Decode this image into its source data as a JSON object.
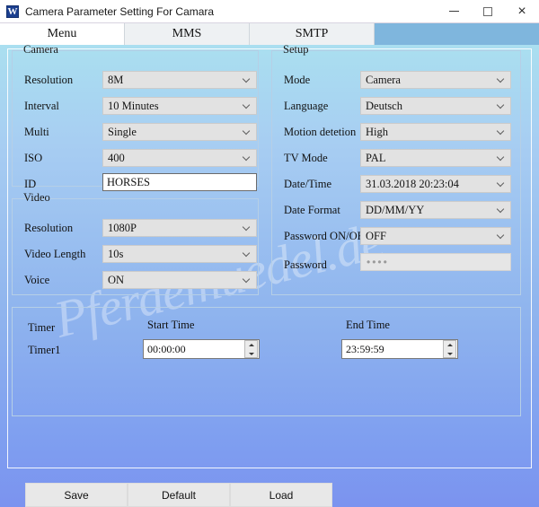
{
  "window": {
    "title": "Camera Parameter Setting For  Camara",
    "icon": "app-icon",
    "minimize_label": "minimize",
    "maximize_label": "maximize",
    "close_label": "×"
  },
  "tabs": [
    {
      "label": "Menu",
      "active": true
    },
    {
      "label": "MMS",
      "active": false
    },
    {
      "label": "SMTP",
      "active": false
    }
  ],
  "watermark": "Pferdemuedel.de",
  "camera": {
    "legend": "Camera",
    "fields": [
      {
        "label": "Resolution",
        "value": "8M",
        "type": "combo"
      },
      {
        "label": "Interval",
        "value": "10 Minutes",
        "type": "combo"
      },
      {
        "label": "Multi",
        "value": "Single",
        "type": "combo"
      },
      {
        "label": "ISO",
        "value": "400",
        "type": "combo"
      },
      {
        "label": "ID",
        "value": "HORSES",
        "type": "text"
      }
    ]
  },
  "video": {
    "legend": "Video",
    "fields": [
      {
        "label": "Resolution",
        "value": "1080P",
        "type": "combo"
      },
      {
        "label": "Video Length",
        "value": "10s",
        "type": "combo"
      },
      {
        "label": "Voice",
        "value": "ON",
        "type": "combo"
      }
    ]
  },
  "setup": {
    "legend": "Setup",
    "fields": [
      {
        "label": "Mode",
        "value": "Camera",
        "type": "combo"
      },
      {
        "label": "Language",
        "value": "Deutsch",
        "type": "combo"
      },
      {
        "label": "Motion detetion",
        "value": "High",
        "type": "combo"
      },
      {
        "label": "TV Mode",
        "value": "PAL",
        "type": "combo"
      },
      {
        "label": "Date/Time",
        "value": "31.03.2018 20:23:04",
        "type": "combo"
      },
      {
        "label": "Date Format",
        "value": "DD/MM/YY",
        "type": "combo"
      },
      {
        "label": "Password ON/OFF",
        "value": "OFF",
        "type": "combo"
      },
      {
        "label": "Password",
        "value": "••••",
        "type": "password"
      }
    ]
  },
  "timer": {
    "label": "Timer",
    "row_label": "Timer1",
    "start_header": "Start Time",
    "end_header": "End Time",
    "start_value": "00:00:00",
    "end_value": "23:59:59"
  },
  "buttons": [
    {
      "label": "Save"
    },
    {
      "label": "Default"
    },
    {
      "label": "Load"
    }
  ],
  "colors": {
    "accent": "#7fb6dd",
    "body_top": "#aadff0",
    "body_bottom": "#7b93ef",
    "group_border": "#b6cfe6",
    "combo_bg": "#e2e2e2"
  }
}
